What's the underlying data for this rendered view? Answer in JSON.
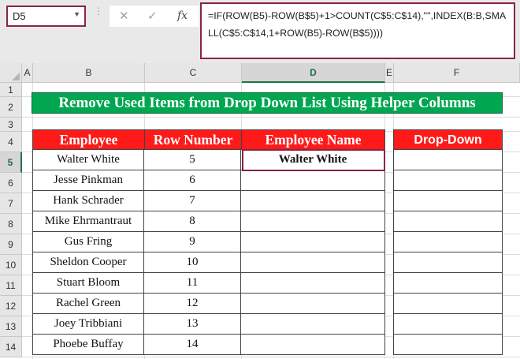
{
  "name_box": "D5",
  "formula": "=IF(ROW(B5)-ROW(B$5)+1>COUNT(C$5:C$14),\"\",INDEX(B:B,SMALL(C$5:C$14,1+ROW(B5)-ROW(B$5))))",
  "fx_label": "fx",
  "columns": [
    "A",
    "B",
    "C",
    "D",
    "E",
    "F"
  ],
  "rows": [
    "1",
    "2",
    "3",
    "4",
    "5",
    "6",
    "7",
    "8",
    "9",
    "10",
    "11",
    "12",
    "13",
    "14"
  ],
  "title": "Remove Used Items from Drop Down List Using Helper Columns",
  "headers": {
    "employee": "Employee",
    "row_number": "Row Number",
    "employee_name": "Employee Name",
    "drop_down": "Drop-Down"
  },
  "employees": [
    {
      "name": "Walter White",
      "row": "5"
    },
    {
      "name": "Jesse Pinkman",
      "row": "6"
    },
    {
      "name": "Hank Schrader",
      "row": "7"
    },
    {
      "name": "Mike Ehrmantraut",
      "row": "8"
    },
    {
      "name": "Gus Fring",
      "row": "9"
    },
    {
      "name": "Sheldon Cooper",
      "row": "10"
    },
    {
      "name": "Stuart Bloom",
      "row": "11"
    },
    {
      "name": "Rachel Green",
      "row": "12"
    },
    {
      "name": "Joey Tribbiani",
      "row": "13"
    },
    {
      "name": "Phoebe Buffay",
      "row": "14"
    }
  ],
  "employee_name_values": [
    "Walter White",
    "",
    "",
    "",
    "",
    "",
    "",
    "",
    "",
    ""
  ],
  "drop_down_values": [
    "",
    "",
    "",
    "",
    "",
    "",
    "",
    "",
    "",
    ""
  ],
  "colors": {
    "title_bg": "#00a650",
    "header_bg": "#ff1a1a",
    "selection": "#8b2344"
  }
}
